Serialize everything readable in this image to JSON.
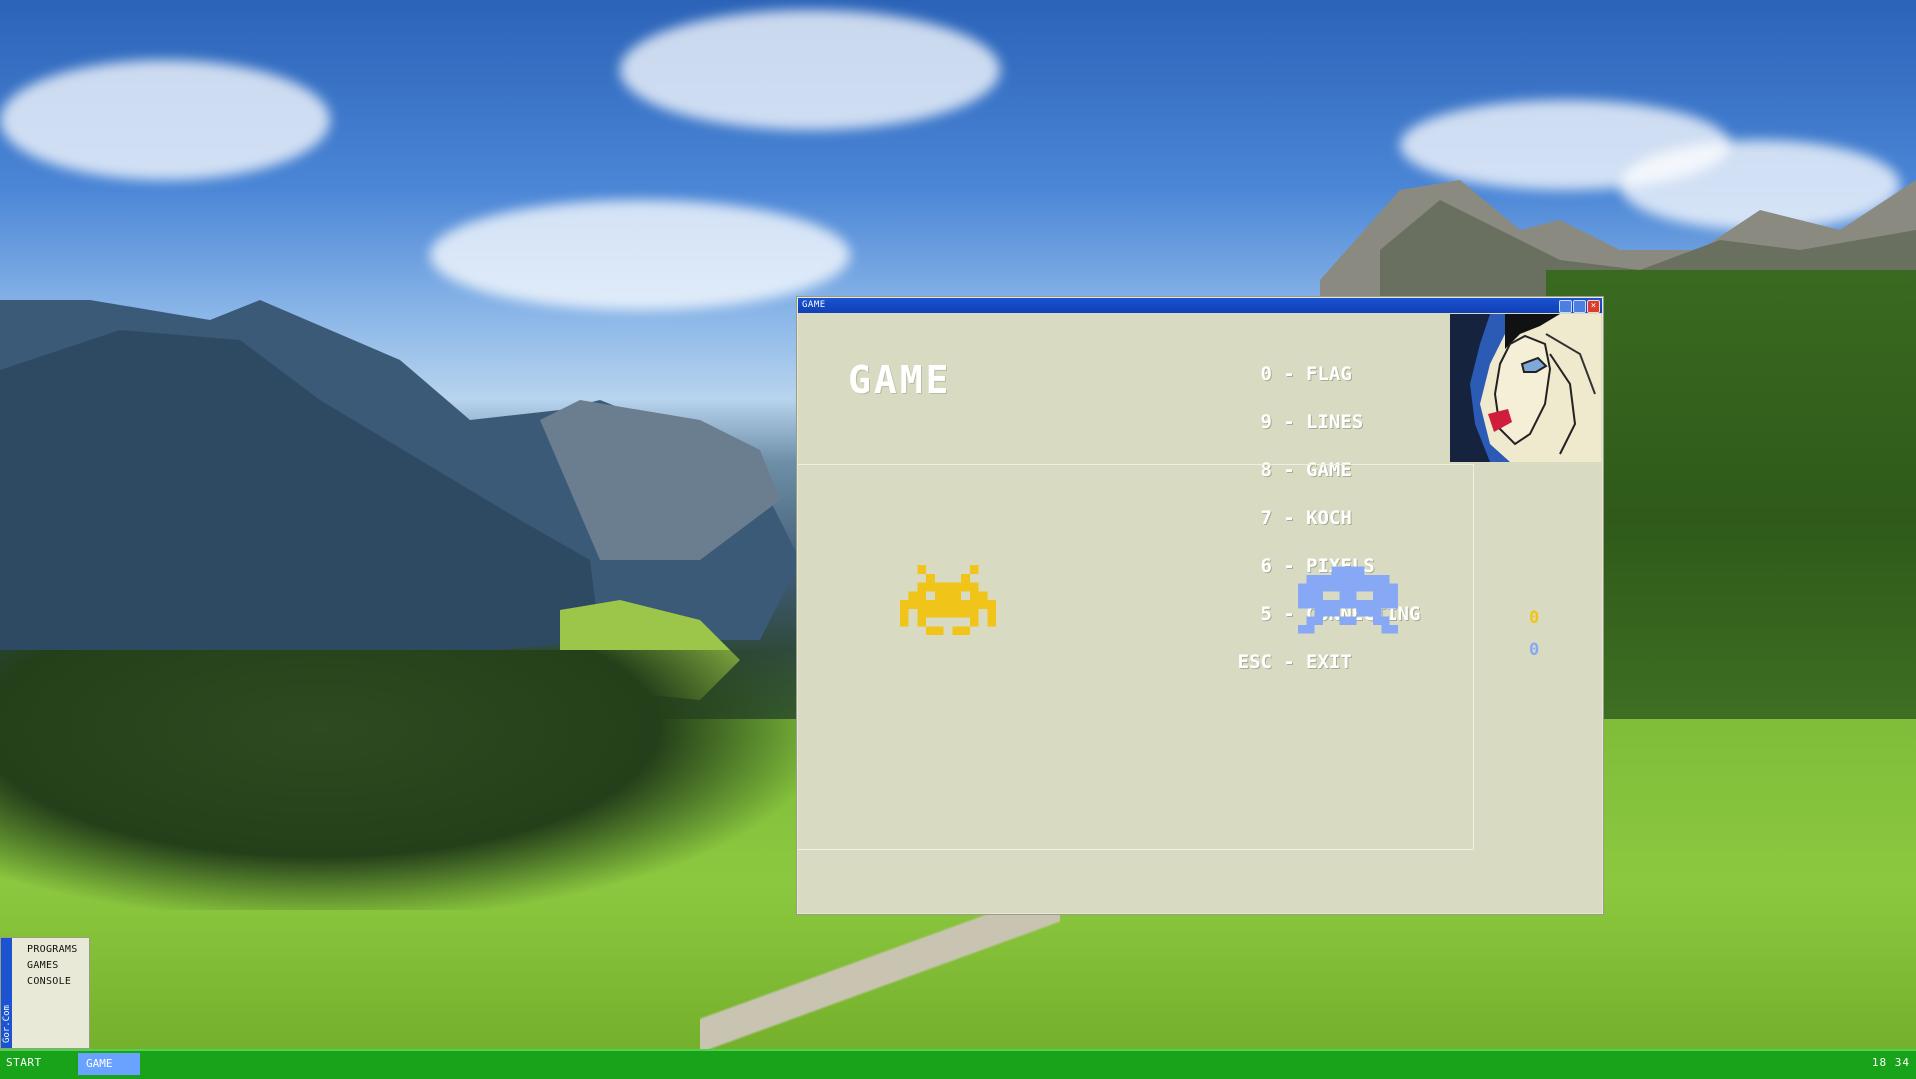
{
  "window": {
    "title": "GAME",
    "heading": "GAME",
    "menu": [
      {
        "key": "0",
        "label": "FLAG"
      },
      {
        "key": "9",
        "label": "LINES"
      },
      {
        "key": "8",
        "label": "GAME"
      },
      {
        "key": "7",
        "label": "KOCH"
      },
      {
        "key": "6",
        "label": "PIXELS"
      },
      {
        "key": "5",
        "label": "CONNECTING"
      },
      {
        "key": "ESC",
        "label": "EXIT"
      }
    ],
    "scores": {
      "player1": "0",
      "player2": "0"
    },
    "colors": {
      "player1": "#f0c419",
      "player2": "#87a9f5"
    },
    "sprites": {
      "player1": "space-invader-yellow",
      "player2": "space-invader-blue"
    }
  },
  "start_menu": {
    "brand": "Gor.Com",
    "items": [
      "PROGRAMS",
      "GAMES",
      "CONSOLE"
    ]
  },
  "taskbar": {
    "start_label": "START",
    "task_label": "GAME",
    "clock": "18 34"
  }
}
